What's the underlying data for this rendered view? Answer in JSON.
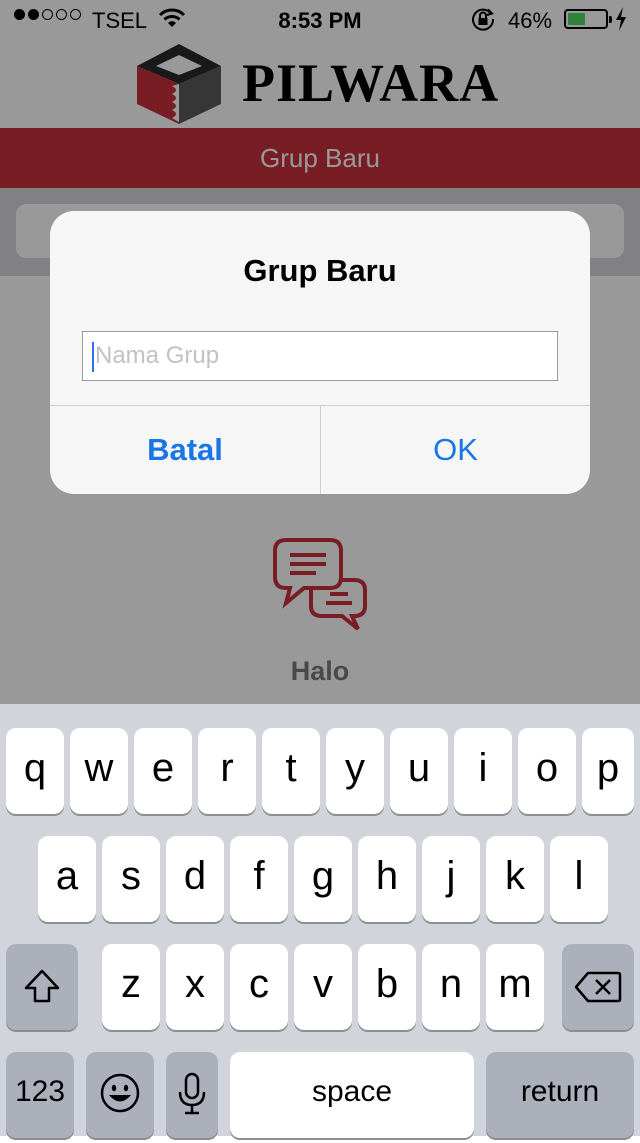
{
  "status_bar": {
    "carrier": "TSEL",
    "time": "8:53 PM",
    "battery": "46%",
    "battery_level": 0.46,
    "signal_bars_filled": 2,
    "signal_bars_total": 5
  },
  "logo": {
    "brand": "PILWARA"
  },
  "title_bar": {
    "title": "Grup Baru"
  },
  "content": {
    "empty_label": "Halo"
  },
  "alert": {
    "title": "Grup Baru",
    "input_placeholder": "Nama Grup",
    "input_value": "",
    "cancel_label": "Batal",
    "ok_label": "OK"
  },
  "keyboard": {
    "row1": [
      "q",
      "w",
      "e",
      "r",
      "t",
      "y",
      "u",
      "i",
      "o",
      "p"
    ],
    "row2": [
      "a",
      "s",
      "d",
      "f",
      "g",
      "h",
      "j",
      "k",
      "l"
    ],
    "row3": [
      "z",
      "x",
      "c",
      "v",
      "b",
      "n",
      "m"
    ],
    "numbers_label": "123",
    "space_label": "space",
    "return_label": "return"
  },
  "colors": {
    "brand_red": "#c9313b",
    "link_blue": "#1976e8",
    "battery_green": "#4cd964",
    "logo_gray": "#5a5a5a"
  },
  "icons": [
    "wifi-icon",
    "lock-rotation-icon",
    "battery-icon",
    "charging-bolt-icon",
    "pilwara-logo-icon",
    "chat-bubbles-icon",
    "shift-icon",
    "backspace-icon",
    "emoji-icon",
    "microphone-icon"
  ]
}
